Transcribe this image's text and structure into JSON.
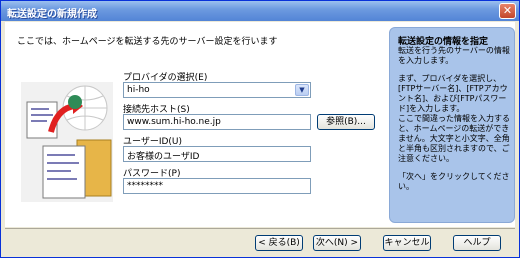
{
  "window": {
    "title": "転送設定の新規作成",
    "close": "✕"
  },
  "main": {
    "intro": "ここでは、ホームページを転送する先のサーバー設定を行います",
    "provider": {
      "label": "プロバイダの選択(E)",
      "value": "hi-ho"
    },
    "host": {
      "label": "接続先ホスト(S)",
      "value": "www.sum.hi-ho.ne.jp",
      "browse": "参照(B)..."
    },
    "user": {
      "label": "ユーザーID(U)",
      "value": "お客様のユーザID"
    },
    "password": {
      "label": "パスワード(P)",
      "value": "********"
    }
  },
  "side": {
    "title": "転送設定の情報を指定",
    "paragraphs": [
      "転送を行う先のサーバーの情報を入力します。",
      "まず、プロバイダを選択し、[FTPサーバー名]、[FTPアカウント名]、および[FTPパスワード]を入力します。\nここで間違った情報を入力すると、ホームページの転送ができません。大文字と小文字、全角と半角も区別されますので、ご注意ください。",
      "「次へ」をクリックしてください。"
    ]
  },
  "buttons": {
    "back": "< 戻る(B)",
    "next": "次へ(N) >",
    "cancel": "キャンセル",
    "help": "ヘルプ"
  },
  "colors": {
    "titlebar": "#5384d6",
    "side_panel": "#a9c4ea"
  }
}
